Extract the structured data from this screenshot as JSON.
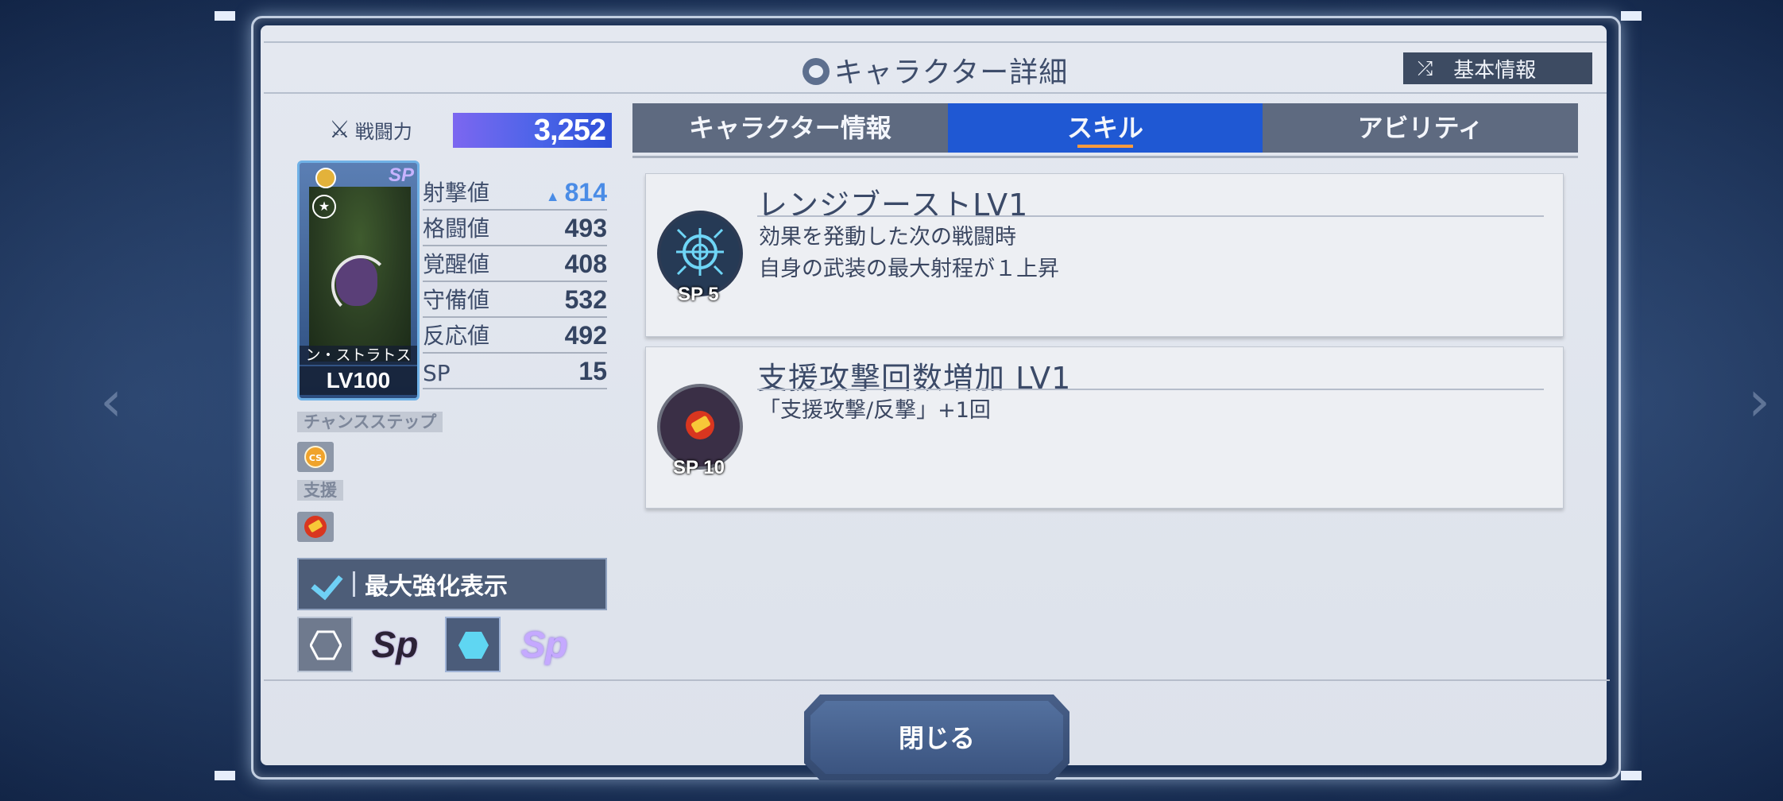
{
  "header": {
    "title": "キャラクター詳細",
    "basic_info_button": "基本情報"
  },
  "power": {
    "label": "戦闘力",
    "value": "3,252"
  },
  "character_card": {
    "name": "ン・ストラトス",
    "level": "LV100",
    "badge": "SP"
  },
  "stats": [
    {
      "name": "射撃値",
      "value": "814",
      "boosted": true
    },
    {
      "name": "格闘値",
      "value": "493"
    },
    {
      "name": "覚醒値",
      "value": "408"
    },
    {
      "name": "守備値",
      "value": "532"
    },
    {
      "name": "反応値",
      "value": "492"
    },
    {
      "name": "SP",
      "value": "15"
    }
  ],
  "chance_step": {
    "label": "チャンスステップ",
    "icon_text": "CS"
  },
  "support": {
    "label": "支援"
  },
  "max_enhance": {
    "label": "最大強化表示",
    "checked": true
  },
  "bottom_icons": [
    "hexagon-icon",
    "sp-dark-icon",
    "hexagon-filled-icon",
    "sp-color-icon"
  ],
  "bottom_sp_text": "Sp",
  "tabs": [
    {
      "label": "キャラクター情報",
      "active": false
    },
    {
      "label": "スキル",
      "active": true
    },
    {
      "label": "アビリティ",
      "active": false
    }
  ],
  "skills": [
    {
      "title": "レンジブーストLV1",
      "description": "効果を発動した次の戦闘時\n自身の武装の最大射程が１上昇",
      "sp_cost": "SP 5",
      "icon": "crosshair-icon"
    },
    {
      "title": "支援攻撃回数増加 LV1",
      "description": "「支援攻撃/反撃」+1回",
      "sp_cost": "SP 10",
      "icon": "support-attack-icon"
    }
  ],
  "close_button": "閉じる",
  "colors": {
    "active_tab": "#1f58d3",
    "inactive_tab": "#5e6a80",
    "boost_value": "#4a8ce6",
    "tab_underline": "#ff9a3c"
  }
}
